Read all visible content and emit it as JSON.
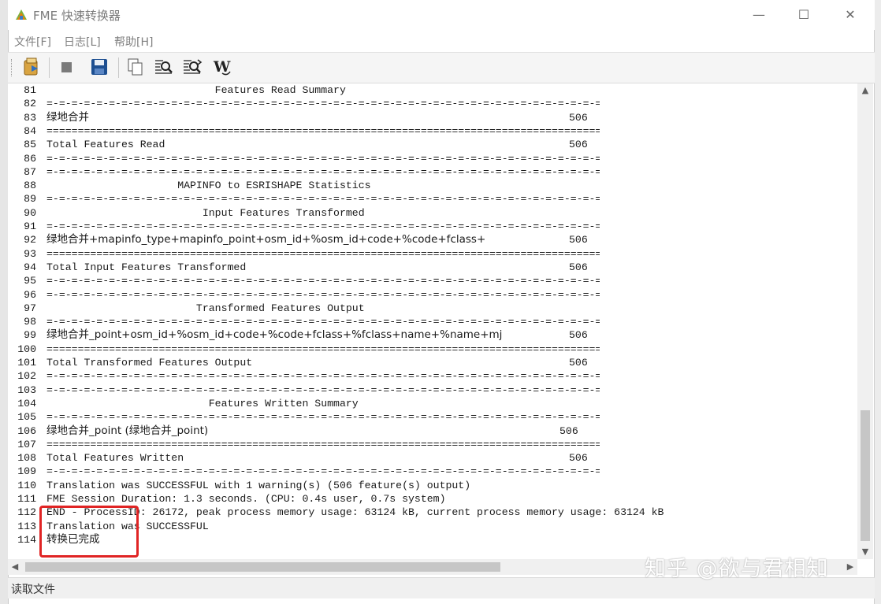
{
  "window": {
    "title": "FME 快速转换器",
    "controls": {
      "minimize": "—",
      "maximize": "☐",
      "close": "✕"
    }
  },
  "menu": [
    {
      "label": "文件[F]"
    },
    {
      "label": "日志[L]"
    },
    {
      "label": "帮助[H]"
    }
  ],
  "toolbar": {
    "buttons": [
      {
        "name": "translate-icon"
      },
      {
        "name": "stop-icon"
      },
      {
        "name": "save-icon"
      },
      {
        "name": "copy-icon"
      },
      {
        "name": "find-icon"
      },
      {
        "name": "find-next-icon"
      },
      {
        "name": "wrap-icon",
        "glyph": "W"
      }
    ]
  },
  "log": [
    {
      "n": "81",
      "text": "                           Features Read Summary"
    },
    {
      "n": "82",
      "text": "=-=-=-=-=-=-=-=-=-=-=-=-=-=-=-=-=-=-=-=-=-=-=-=-=-=-=-=-=-=-=-=-=-=-=-=-=-=-=-=-=-=-=-=-=-=-=-"
    },
    {
      "n": "83",
      "text": "绿地合并",
      "count": "506",
      "cjk": true
    },
    {
      "n": "84",
      "text": "==========================================================================================="
    },
    {
      "n": "85",
      "text": "Total Features Read",
      "count": "506"
    },
    {
      "n": "86",
      "text": "=-=-=-=-=-=-=-=-=-=-=-=-=-=-=-=-=-=-=-=-=-=-=-=-=-=-=-=-=-=-=-=-=-=-=-=-=-=-=-=-=-=-=-=-=-=-=-"
    },
    {
      "n": "87",
      "text": "=-=-=-=-=-=-=-=-=-=-=-=-=-=-=-=-=-=-=-=-=-=-=-=-=-=-=-=-=-=-=-=-=-=-=-=-=-=-=-=-=-=-=-=-=-=-=-"
    },
    {
      "n": "88",
      "text": "                     MAPINFO to ESRISHAPE Statistics"
    },
    {
      "n": "89",
      "text": "=-=-=-=-=-=-=-=-=-=-=-=-=-=-=-=-=-=-=-=-=-=-=-=-=-=-=-=-=-=-=-=-=-=-=-=-=-=-=-=-=-=-=-=-=-=-=-"
    },
    {
      "n": "90",
      "text": "                         Input Features Transformed"
    },
    {
      "n": "91",
      "text": "=-=-=-=-=-=-=-=-=-=-=-=-=-=-=-=-=-=-=-=-=-=-=-=-=-=-=-=-=-=-=-=-=-=-=-=-=-=-=-=-=-=-=-=-=-=-=-"
    },
    {
      "n": "92",
      "text": "绿地合并+mapinfo_type+mapinfo_point+osm_id+%osm_id+code+%code+fclass+",
      "count": "506",
      "cjk": true
    },
    {
      "n": "93",
      "text": "==========================================================================================="
    },
    {
      "n": "94",
      "text": "Total Input Features Transformed",
      "count": "506"
    },
    {
      "n": "95",
      "text": "=-=-=-=-=-=-=-=-=-=-=-=-=-=-=-=-=-=-=-=-=-=-=-=-=-=-=-=-=-=-=-=-=-=-=-=-=-=-=-=-=-=-=-=-=-=-=-"
    },
    {
      "n": "96",
      "text": "=-=-=-=-=-=-=-=-=-=-=-=-=-=-=-=-=-=-=-=-=-=-=-=-=-=-=-=-=-=-=-=-=-=-=-=-=-=-=-=-=-=-=-=-=-=-=-"
    },
    {
      "n": "97",
      "text": "                        Transformed Features Output"
    },
    {
      "n": "98",
      "text": "=-=-=-=-=-=-=-=-=-=-=-=-=-=-=-=-=-=-=-=-=-=-=-=-=-=-=-=-=-=-=-=-=-=-=-=-=-=-=-=-=-=-=-=-=-=-=-"
    },
    {
      "n": "99",
      "text": "绿地合并_point+osm_id+%osm_id+code+%code+fclass+%fclass+name+%name+mj",
      "count": "506",
      "cjk": true
    },
    {
      "n": "100",
      "text": "==========================================================================================="
    },
    {
      "n": "101",
      "text": "Total Transformed Features Output",
      "count": "506"
    },
    {
      "n": "102",
      "text": "=-=-=-=-=-=-=-=-=-=-=-=-=-=-=-=-=-=-=-=-=-=-=-=-=-=-=-=-=-=-=-=-=-=-=-=-=-=-=-=-=-=-=-=-=-=-=-"
    },
    {
      "n": "103",
      "text": "=-=-=-=-=-=-=-=-=-=-=-=-=-=-=-=-=-=-=-=-=-=-=-=-=-=-=-=-=-=-=-=-=-=-=-=-=-=-=-=-=-=-=-=-=-=-=-"
    },
    {
      "n": "104",
      "text": "                          Features Written Summary"
    },
    {
      "n": "105",
      "text": "=-=-=-=-=-=-=-=-=-=-=-=-=-=-=-=-=-=-=-=-=-=-=-=-=-=-=-=-=-=-=-=-=-=-=-=-=-=-=-=-=-=-=-=-=-=-=-"
    },
    {
      "n": "106",
      "text": "绿地合并_point (绿地合并_point)",
      "count": "506",
      "cjk": true,
      "countShift": true
    },
    {
      "n": "107",
      "text": "==========================================================================================="
    },
    {
      "n": "108",
      "text": "Total Features Written",
      "count": "506"
    },
    {
      "n": "109",
      "text": "=-=-=-=-=-=-=-=-=-=-=-=-=-=-=-=-=-=-=-=-=-=-=-=-=-=-=-=-=-=-=-=-=-=-=-=-=-=-=-=-=-=-=-=-=-=-=-"
    },
    {
      "n": "110",
      "text": "Translation was SUCCESSFUL with 1 warning(s) (506 feature(s) output)"
    },
    {
      "n": "111",
      "text": "FME Session Duration: 1.3 seconds. (CPU: 0.4s user, 0.7s system)"
    },
    {
      "n": "112",
      "text": "END - ProcessID: 26172, peak process memory usage: 63124 kB, current process memory usage: 63124 kB"
    },
    {
      "n": "113",
      "text": "Translation was SUCCESSFUL"
    },
    {
      "n": "114",
      "text": "转换已完成",
      "cjk": true
    }
  ],
  "scroll": {
    "up": "▲",
    "down": "▼",
    "left": "◀",
    "right": "▶"
  },
  "status": {
    "text": "读取文件"
  },
  "watermark": {
    "text": "知乎 @欲与君相知"
  }
}
